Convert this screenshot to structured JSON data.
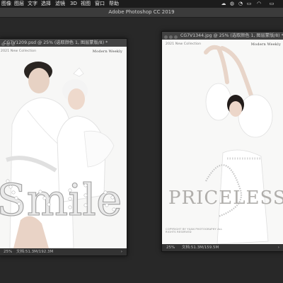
{
  "menubar": {
    "items": [
      "图像",
      "图层",
      "文字",
      "选择",
      "滤镜",
      "3D",
      "视图",
      "窗口",
      "帮助"
    ],
    "status_icons": [
      "cloud-icon",
      "wechat-icon",
      "qq-icon",
      "screen-icon",
      "wifi-icon",
      "battery-icon"
    ]
  },
  "app": {
    "title": "Adobe Photoshop CC 2019"
  },
  "doc_left": {
    "title": "CG7V1209.psd @ 25% (选取颜色 1, 图层蒙版/8) *",
    "zoom": "25%",
    "doc_size": "文档:51.3M/192.3M",
    "poster": {
      "collection": "2021 New Collection",
      "brand": "Modern Weekly",
      "headline": "Smile"
    }
  },
  "doc_right": {
    "title": "CG7V1344.jpg @ 25% (选取颜色 1, 图层蒙版/8) *",
    "zoom": "25%",
    "doc_size": "文档:51.3M/159.5M",
    "poster": {
      "collection": "2021 New Collection",
      "brand": "Modern Weekly",
      "headline": "PRICELESS",
      "footer": "COPYRIGHT BY YUAN PHOTOGRAPHY ALL RIGHTS RESERVED"
    }
  },
  "colors": {
    "menubar": "#1c1c1c",
    "workspace": "#282828",
    "window": "#3a3a3a"
  }
}
